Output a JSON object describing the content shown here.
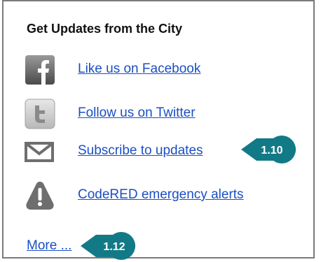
{
  "panel": {
    "title": "Get Updates from the City"
  },
  "links": [
    {
      "label": "Like us on Facebook",
      "icon": "facebook-icon"
    },
    {
      "label": "Follow us on Twitter",
      "icon": "twitter-icon"
    },
    {
      "label": "Subscribe to updates",
      "icon": "envelope-icon"
    },
    {
      "label": "CodeRED emergency alerts",
      "icon": "alert-icon"
    }
  ],
  "more": {
    "label": "More ..."
  },
  "callouts": [
    {
      "label": "1.10"
    },
    {
      "label": "1.12"
    }
  ],
  "colors": {
    "link": "#1a4fc4",
    "callout": "#127a86",
    "icon_dark": "#6e6e6e",
    "border": "#7a7a7a"
  }
}
